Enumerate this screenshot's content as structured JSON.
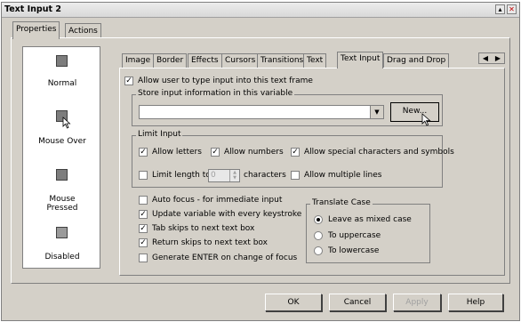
{
  "window": {
    "title": "Text Input 2",
    "min_icon": "minimize-icon",
    "close_icon": "close-icon"
  },
  "outer_tabs": [
    {
      "label": "Properties"
    },
    {
      "label": "Actions"
    }
  ],
  "states": [
    {
      "label": "Normal",
      "icon": "state-normal-icon"
    },
    {
      "label": "Mouse Over",
      "icon": "state-mouse-over-icon"
    },
    {
      "label": "Mouse Pressed",
      "icon": "state-mouse-pressed-icon"
    },
    {
      "label": "Disabled",
      "icon": "state-disabled-icon"
    }
  ],
  "inner_tabs": [
    {
      "label": "Image"
    },
    {
      "label": "Border"
    },
    {
      "label": "Effects"
    },
    {
      "label": "Cursors"
    },
    {
      "label": "Transitions"
    },
    {
      "label": "Text"
    },
    {
      "label": "Text Input"
    },
    {
      "label": "Drag and Drop"
    }
  ],
  "allow_typing": {
    "label": "Allow user to type input into this text frame",
    "checked": true
  },
  "store_group": {
    "label": "Store input information in this variable",
    "variable_value": "",
    "new_label": "New..."
  },
  "limit_group": {
    "label": "Limit Input",
    "allow_letters": {
      "label": "Allow letters",
      "checked": true
    },
    "allow_numbers": {
      "label": "Allow numbers",
      "checked": true
    },
    "allow_special": {
      "label": "Allow special characters and symbols",
      "checked": true
    },
    "limit_length": {
      "label": "Limit length to",
      "checked": false,
      "value": "0",
      "suffix": "characters"
    },
    "allow_multiline": {
      "label": "Allow multiple lines",
      "checked": false
    }
  },
  "options": [
    {
      "label": "Auto focus - for immediate input",
      "checked": false
    },
    {
      "label": "Update variable with every keystroke",
      "checked": true
    },
    {
      "label": "Tab skips to next text box",
      "checked": true
    },
    {
      "label": "Return skips to next text box",
      "checked": true
    },
    {
      "label": "Generate ENTER on change of focus",
      "checked": false
    }
  ],
  "translate_group": {
    "label": "Translate Case",
    "options": [
      {
        "label": "Leave as mixed case",
        "selected": true
      },
      {
        "label": "To uppercase",
        "selected": false
      },
      {
        "label": "To lowercase",
        "selected": false
      }
    ]
  },
  "buttons": {
    "ok": "OK",
    "cancel": "Cancel",
    "apply": "Apply",
    "help": "Help"
  }
}
